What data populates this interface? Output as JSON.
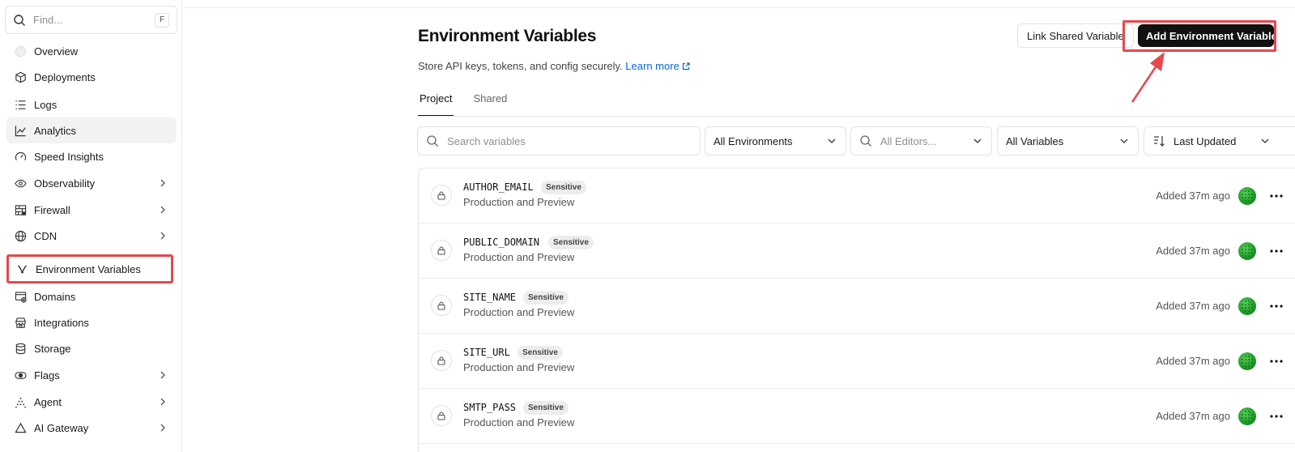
{
  "sidebar": {
    "find_placeholder": "Find...",
    "find_shortcut": "F",
    "items": [
      {
        "label": "Overview",
        "icon": "circle-icon"
      },
      {
        "label": "Deployments",
        "icon": "cube-icon"
      },
      {
        "label": "Logs",
        "icon": "list-icon"
      },
      {
        "label": "Analytics",
        "icon": "chart-line-icon"
      },
      {
        "label": "Speed Insights",
        "icon": "gauge-icon"
      },
      {
        "label": "Observability",
        "icon": "eye-icon"
      },
      {
        "label": "Firewall",
        "icon": "firewall-icon"
      },
      {
        "label": "CDN",
        "icon": "globe-icon"
      },
      {
        "label": "Environment Variables",
        "icon": "variable-icon"
      },
      {
        "label": "Domains",
        "icon": "domain-icon"
      },
      {
        "label": "Integrations",
        "icon": "integrations-icon"
      },
      {
        "label": "Storage",
        "icon": "database-icon"
      },
      {
        "label": "Flags",
        "icon": "toggle-icon"
      },
      {
        "label": "Agent",
        "icon": "agent-icon"
      },
      {
        "label": "AI Gateway",
        "icon": "gateway-icon"
      }
    ]
  },
  "page": {
    "title": "Environment Variables",
    "subtitle": "Store API keys, tokens, and config securely.",
    "learn_more": "Learn more",
    "link_shared_label": "Link Shared Variable",
    "add_label": "Add Environment Variable"
  },
  "tabs": [
    "Project",
    "Shared"
  ],
  "filters": {
    "search_placeholder": "Search variables",
    "environments": "All Environments",
    "editors_placeholder": "All Editors...",
    "variables": "All Variables",
    "sort": "Last Updated"
  },
  "variables": [
    {
      "name": "AUTHOR_EMAIL",
      "badge": "Sensitive",
      "env": "Production and Preview",
      "added": "Added 37m ago"
    },
    {
      "name": "PUBLIC_DOMAIN",
      "badge": "Sensitive",
      "env": "Production and Preview",
      "added": "Added 37m ago"
    },
    {
      "name": "SITE_NAME",
      "badge": "Sensitive",
      "env": "Production and Preview",
      "added": "Added 37m ago"
    },
    {
      "name": "SITE_URL",
      "badge": "Sensitive",
      "env": "Production and Preview",
      "added": "Added 37m ago"
    },
    {
      "name": "SMTP_PASS",
      "badge": "Sensitive",
      "env": "Production and Preview",
      "added": "Added 37m ago"
    }
  ],
  "colors": {
    "accent_link": "#0a66d8",
    "primary_button": "#111111",
    "annotation_red": "#e5484d"
  }
}
